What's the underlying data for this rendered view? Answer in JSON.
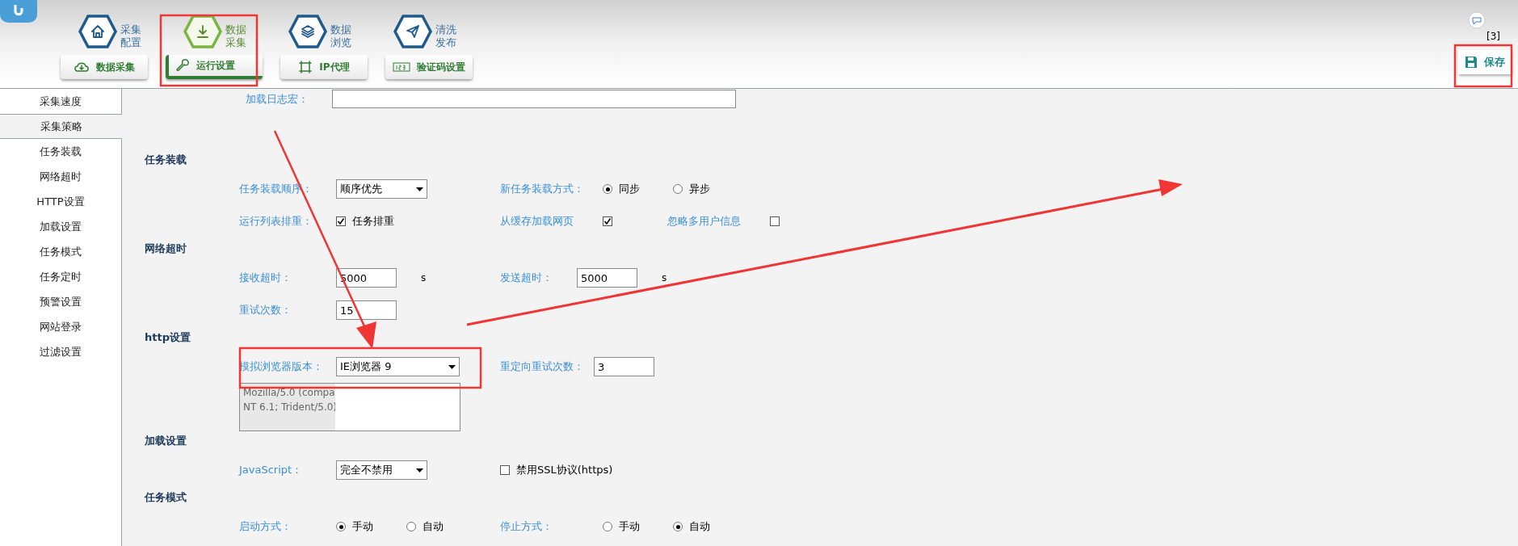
{
  "header": {
    "modules": [
      {
        "lines": [
          "采集",
          "配置"
        ],
        "selected": false
      },
      {
        "lines": [
          "数据",
          "采集"
        ],
        "selected": true
      },
      {
        "lines": [
          "数据",
          "浏览"
        ],
        "selected": false
      },
      {
        "lines": [
          "清洗",
          "发布"
        ],
        "selected": false
      }
    ],
    "tool_buttons": [
      {
        "label": "数据采集",
        "selected": false
      },
      {
        "label": "运行设置",
        "selected": true
      },
      {
        "label": "IP代理",
        "selected": false
      },
      {
        "label": "验证码设置",
        "selected": false
      }
    ],
    "notification_count": "[3]",
    "save_button": "保存"
  },
  "sidebar": {
    "items": [
      {
        "label": "采集速度",
        "selected": false
      },
      {
        "label": "采集策略",
        "selected": true
      },
      {
        "label": "任务装载",
        "selected": false
      },
      {
        "label": "网络超时",
        "selected": false
      },
      {
        "label": "HTTP设置",
        "selected": false
      },
      {
        "label": "加载设置",
        "selected": false
      },
      {
        "label": "任务模式",
        "selected": false
      },
      {
        "label": "任务定时",
        "selected": false
      },
      {
        "label": "预警设置",
        "selected": false
      },
      {
        "label": "网站登录",
        "selected": false
      },
      {
        "label": "过滤设置",
        "selected": false
      }
    ]
  },
  "log_macro": {
    "label": "加载日志宏："
  },
  "sections": [
    {
      "title": "任务装载",
      "rows": [
        [
          {
            "kind": "select",
            "label": "任务装载顺序：",
            "value": "顺序优先"
          },
          {
            "kind": "radio",
            "label": "新任务装载方式：",
            "options": [
              {
                "label": "同步",
                "selected": true
              },
              {
                "label": "异步",
                "selected": false
              }
            ]
          }
        ],
        [
          {
            "kind": "check",
            "label": "运行列表排重：",
            "checked": true,
            "text": "任务排重"
          },
          {
            "kind": "check",
            "label": "从缓存加载网页",
            "checked": true
          },
          {
            "kind": "check",
            "label": "忽略多用户信息",
            "checked": false
          }
        ]
      ]
    },
    {
      "title": "网络超时",
      "rows": [
        [
          {
            "kind": "input",
            "label": "接收超时：",
            "value": "5000",
            "unit": "s"
          },
          {
            "kind": "input",
            "label": "发送超时：",
            "value": "5000",
            "unit": "s"
          }
        ],
        [
          {
            "kind": "input",
            "label": "重试次数：",
            "value": "15"
          }
        ]
      ]
    },
    {
      "title": "http设置",
      "rows": [
        [
          {
            "kind": "select",
            "label": "模拟浏览器版本：",
            "value": "IE浏览器 9"
          },
          {
            "kind": "input",
            "label": "重定向重试次数：",
            "value": "3"
          }
        ],
        [
          {
            "kind": "textarea",
            "lines": [
              "Mozilla/5.0 (compa",
              "NT 6.1; Trident/5.0)"
            ]
          }
        ]
      ]
    },
    {
      "title": "加载设置",
      "rows": [
        [
          {
            "kind": "select",
            "label": "JavaScript：",
            "value": "完全不禁用"
          },
          {
            "kind": "check",
            "checked": false,
            "text": "禁用SSL协议(https)"
          }
        ]
      ]
    },
    {
      "title": "任务模式",
      "rows": [
        [
          {
            "kind": "radio",
            "label": "启动方式：",
            "options": [
              {
                "label": "手动",
                "selected": true
              },
              {
                "label": "自动",
                "selected": false
              }
            ]
          },
          {
            "kind": "radio",
            "label": "停止方式：",
            "options": [
              {
                "label": "手动",
                "selected": false
              },
              {
                "label": "自动",
                "selected": true
              }
            ]
          }
        ]
      ]
    }
  ]
}
